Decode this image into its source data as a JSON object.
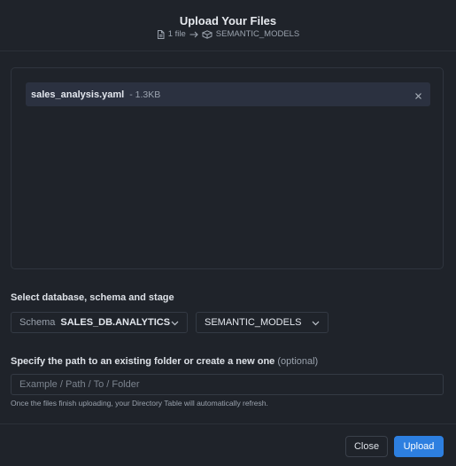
{
  "dialog": {
    "title": "Upload Your Files",
    "file_count": "1 file",
    "destination": "SEMANTIC_MODELS"
  },
  "files": [
    {
      "name": "sales_analysis.yaml",
      "size": "- 1.3KB"
    }
  ],
  "stage_selector": {
    "label": "Select database, schema and stage",
    "schema_prefix": "Schema",
    "schema_value": "SALES_DB.ANALYTICS",
    "stage_value": "SEMANTIC_MODELS"
  },
  "path": {
    "label": "Specify the path to an existing folder or create a new one",
    "optional": "(optional)",
    "placeholder": "Example / Path / To / Folder",
    "value": "",
    "hint": "Once the files finish uploading, your Directory Table will automatically refresh."
  },
  "footer": {
    "close_label": "Close",
    "upload_label": "Upload"
  },
  "colors": {
    "background": "#1f232a",
    "accent": "#2d7fe0",
    "file_row": "#2b3140"
  }
}
